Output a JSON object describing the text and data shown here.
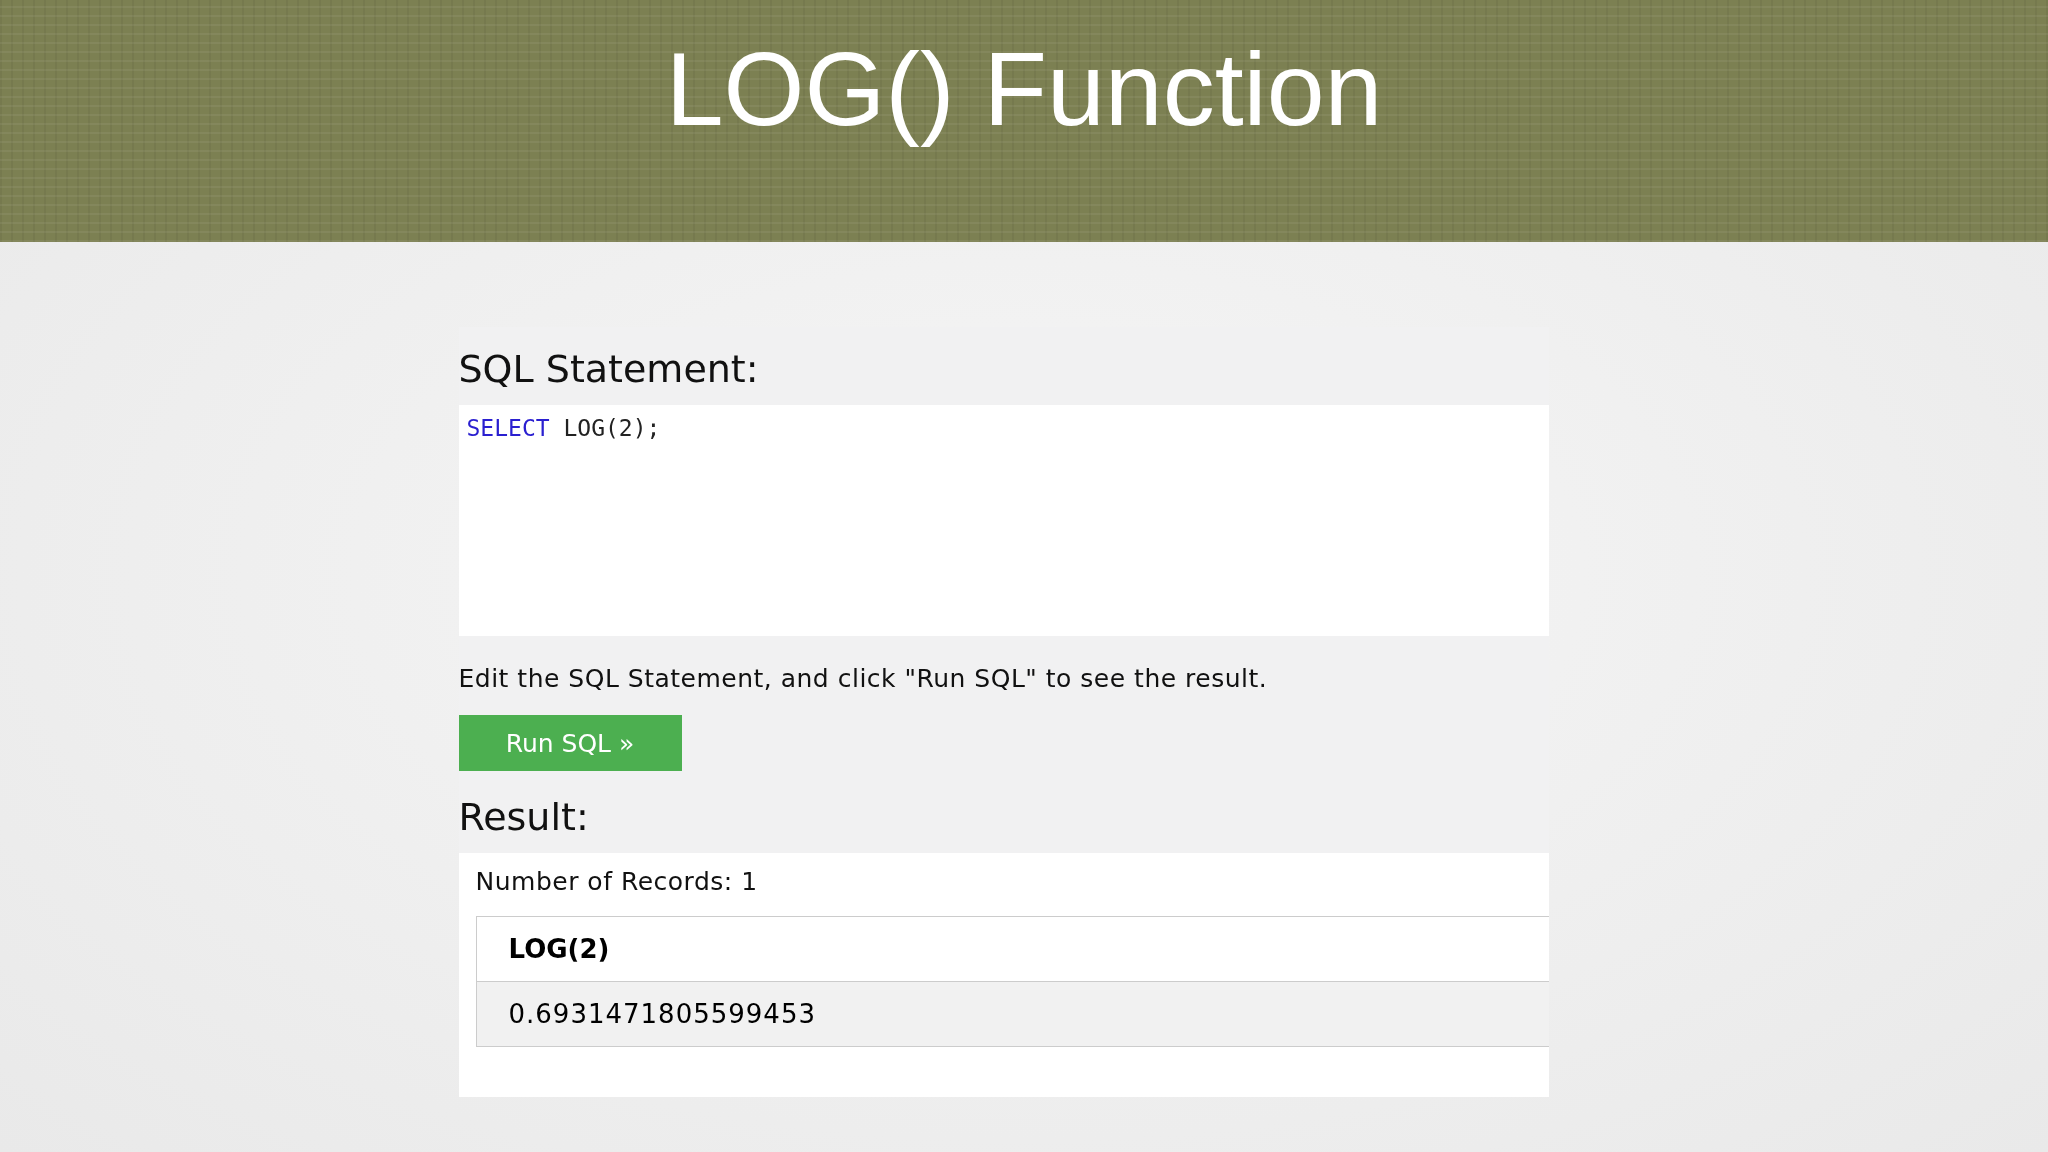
{
  "slide_title": "LOG() Function",
  "sql_heading": "SQL Statement:",
  "editor": {
    "tokens": [
      {
        "kind": "keyword",
        "text": "SELECT"
      },
      {
        "kind": "plain",
        "text": " LOG(2);"
      }
    ]
  },
  "instruction": "Edit the SQL Statement, and click \"Run SQL\" to see the result.",
  "run_button": "Run SQL »",
  "result_heading": "Result:",
  "record_count": "Number of Records: 1",
  "table": {
    "columns": [
      "LOG(2)"
    ],
    "rows": [
      [
        "0.6931471805599453"
      ]
    ]
  }
}
